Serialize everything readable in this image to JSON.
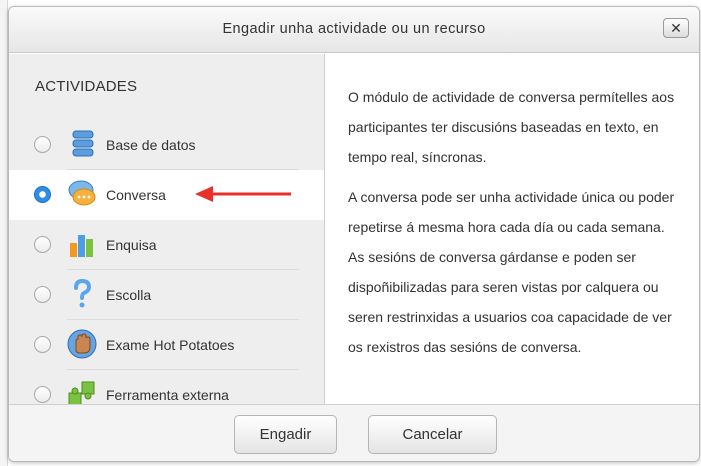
{
  "dialog": {
    "title": "Engadir unha actividade ou un recurso",
    "close_label": "✕"
  },
  "left_panel": {
    "section_heading": "ACTIVIDADES",
    "items": [
      {
        "label": "Base de datos",
        "icon": "database-icon",
        "selected": false
      },
      {
        "label": "Conversa",
        "icon": "chat-icon",
        "selected": true
      },
      {
        "label": "Enquisa",
        "icon": "bar-chart-icon",
        "selected": false
      },
      {
        "label": "Escolla",
        "icon": "question-mark-icon",
        "selected": false
      },
      {
        "label": "Exame Hot Potatoes",
        "icon": "hot-potatoes-hand-icon",
        "selected": false
      },
      {
        "label": "Ferramenta externa",
        "icon": "puzzle-piece-icon",
        "selected": false
      }
    ]
  },
  "description": {
    "paragraphs": [
      "O módulo de actividade de conversa permítelles aos participantes ter discusións baseadas en texto, en tempo real, síncronas.",
      "A conversa pode ser unha actividade única ou poder repetirse á mesma hora cada día ou cada semana. As sesións de conversa gárdanse e poden ser dispoñibilizadas para seren vistas por calquera ou seren restrinxidas a usuarios coa capacidade de ver os rexistros das sesións de conversa."
    ]
  },
  "footer": {
    "add_label": "Engadir",
    "cancel_label": "Cancelar"
  },
  "colors": {
    "annotation_arrow": "#e8312a",
    "radio_selected": "#2f8de4"
  }
}
